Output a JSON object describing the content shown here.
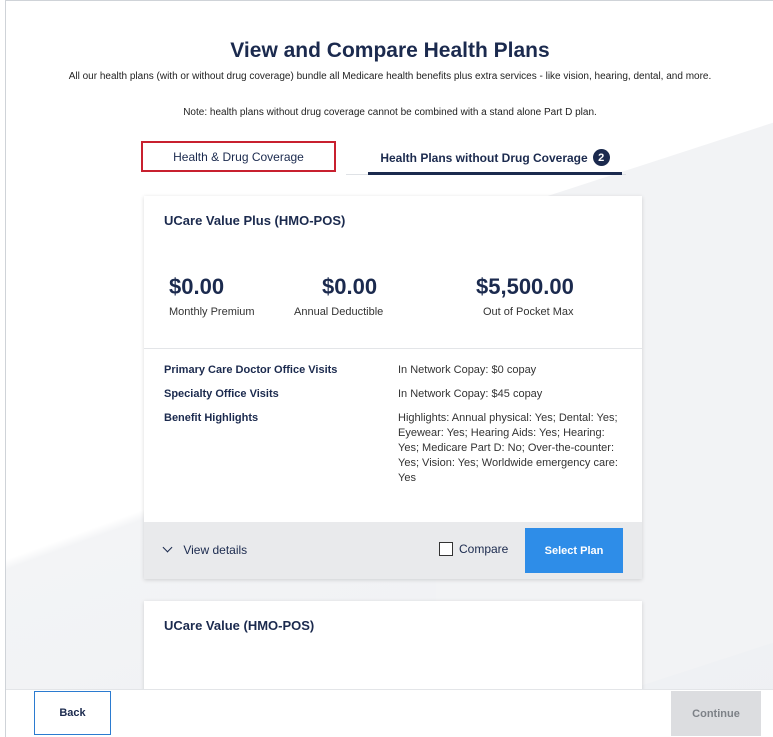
{
  "header": {
    "title": "View and Compare Health Plans",
    "subtitle": "All our health plans (with or without drug coverage) bundle all Medicare health benefits plus extra services - like vision, hearing, dental, and more.",
    "note": "Note: health plans without drug coverage cannot be combined with a stand alone Part D plan."
  },
  "tabs": [
    {
      "label": "Health & Drug Coverage",
      "active": false
    },
    {
      "label": "Health Plans without Drug Coverage",
      "active": true,
      "count": "2"
    }
  ],
  "plans": [
    {
      "name": "UCare Value Plus (HMO-POS)",
      "stats": [
        {
          "amount": "$0.00",
          "label": "Monthly Premium"
        },
        {
          "amount": "$0.00",
          "label": "Annual Deductible"
        },
        {
          "amount": "$5,500.00",
          "label": "Out of Pocket Max"
        }
      ],
      "benefits": [
        {
          "name": "Primary Care Doctor Office Visits",
          "value": "In Network Copay: $0 copay"
        },
        {
          "name": "Specialty Office Visits",
          "value": "In Network Copay: $45 copay"
        },
        {
          "name": "Benefit Highlights",
          "value": "Highlights: Annual physical: Yes; Dental: Yes; Eyewear: Yes; Hearing Aids: Yes; Hearing: Yes; Medicare Part D: No; Over-the-counter: Yes; Vision: Yes; Worldwide emergency care: Yes"
        }
      ],
      "view_details": "View details",
      "compare": "Compare",
      "select": "Select Plan"
    },
    {
      "name": "UCare Value (HMO-POS)"
    }
  ],
  "footer": {
    "back": "Back",
    "continue": "Continue"
  }
}
